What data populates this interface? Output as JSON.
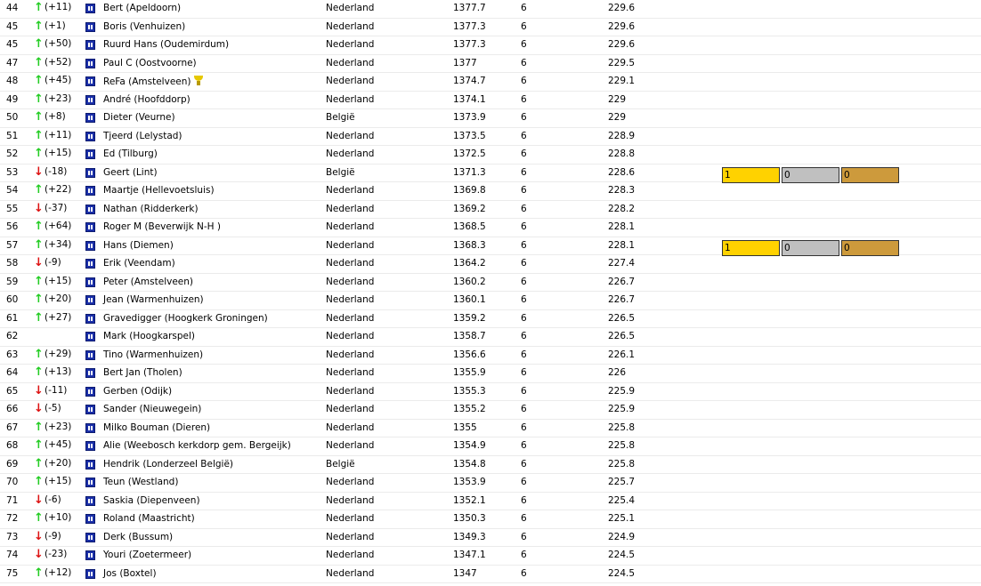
{
  "icons": {
    "trend_up": "arrow-up-icon",
    "trend_down": "arrow-down-icon",
    "flag": "flag-icon",
    "trophy": "trophy-icon"
  },
  "colors": {
    "trend_up": "#22cc22",
    "trend_down": "#dd1111",
    "gold": "#ffd200",
    "silver": "#c0c0c0",
    "bronze": "#cd9a3c"
  },
  "rows": [
    {
      "pos": "44",
      "dir": "up",
      "delta": "(+11)",
      "name": "Bert (Apeldoorn)",
      "country": "Nederland",
      "score": "1377.7",
      "games": "6",
      "avg": "229.6"
    },
    {
      "pos": "45",
      "dir": "up",
      "delta": "(+1)",
      "name": "Boris (Venhuizen)",
      "country": "Nederland",
      "score": "1377.3",
      "games": "6",
      "avg": "229.6"
    },
    {
      "pos": "45",
      "dir": "up",
      "delta": "(+50)",
      "name": "Ruurd Hans (Oudemirdum)",
      "country": "Nederland",
      "score": "1377.3",
      "games": "6",
      "avg": "229.6"
    },
    {
      "pos": "47",
      "dir": "up",
      "delta": "(+52)",
      "name": "Paul C (Oostvoorne)",
      "country": "Nederland",
      "score": "1377",
      "games": "6",
      "avg": "229.5"
    },
    {
      "pos": "48",
      "dir": "up",
      "delta": "(+45)",
      "name": "ReFa (Amstelveen)",
      "trophy": true,
      "country": "Nederland",
      "score": "1374.7",
      "games": "6",
      "avg": "229.1"
    },
    {
      "pos": "49",
      "dir": "up",
      "delta": "(+23)",
      "name": "André (Hoofddorp)",
      "country": "Nederland",
      "score": "1374.1",
      "games": "6",
      "avg": "229"
    },
    {
      "pos": "50",
      "dir": "up",
      "delta": "(+8)",
      "name": "Dieter (Veurne)",
      "country": "België",
      "score": "1373.9",
      "games": "6",
      "avg": "229"
    },
    {
      "pos": "51",
      "dir": "up",
      "delta": "(+11)",
      "name": "Tjeerd (Lelystad)",
      "country": "Nederland",
      "score": "1373.5",
      "games": "6",
      "avg": "228.9"
    },
    {
      "pos": "52",
      "dir": "up",
      "delta": "(+15)",
      "name": "Ed (Tilburg)",
      "country": "Nederland",
      "score": "1372.5",
      "games": "6",
      "avg": "228.8"
    },
    {
      "pos": "53",
      "dir": "down",
      "delta": "(-18)",
      "name": "Geert (Lint)",
      "country": "België",
      "score": "1371.3",
      "games": "6",
      "avg": "228.6",
      "medals": [
        "1",
        "0",
        "0"
      ]
    },
    {
      "pos": "54",
      "dir": "up",
      "delta": "(+22)",
      "name": "Maartje (Hellevoetsluis)",
      "country": "Nederland",
      "score": "1369.8",
      "games": "6",
      "avg": "228.3"
    },
    {
      "pos": "55",
      "dir": "down",
      "delta": "(-37)",
      "name": "Nathan (Ridderkerk)",
      "country": "Nederland",
      "score": "1369.2",
      "games": "6",
      "avg": "228.2"
    },
    {
      "pos": "56",
      "dir": "up",
      "delta": "(+64)",
      "name": "Roger M (Beverwijk N-H )",
      "country": "Nederland",
      "score": "1368.5",
      "games": "6",
      "avg": "228.1"
    },
    {
      "pos": "57",
      "dir": "up",
      "delta": "(+34)",
      "name": "Hans (Diemen)",
      "country": "Nederland",
      "score": "1368.3",
      "games": "6",
      "avg": "228.1",
      "medals": [
        "1",
        "0",
        "0"
      ]
    },
    {
      "pos": "58",
      "dir": "down",
      "delta": "(-9)",
      "name": "Erik (Veendam)",
      "country": "Nederland",
      "score": "1364.2",
      "games": "6",
      "avg": "227.4"
    },
    {
      "pos": "59",
      "dir": "up",
      "delta": "(+15)",
      "name": "Peter (Amstelveen)",
      "country": "Nederland",
      "score": "1360.2",
      "games": "6",
      "avg": "226.7"
    },
    {
      "pos": "60",
      "dir": "up",
      "delta": "(+20)",
      "name": "Jean (Warmenhuizen)",
      "country": "Nederland",
      "score": "1360.1",
      "games": "6",
      "avg": "226.7"
    },
    {
      "pos": "61",
      "dir": "up",
      "delta": "(+27)",
      "name": "Gravedigger (Hoogkerk Groningen)",
      "country": "Nederland",
      "score": "1359.2",
      "games": "6",
      "avg": "226.5"
    },
    {
      "pos": "62",
      "dir": "",
      "delta": "",
      "name": "Mark (Hoogkarspel)",
      "country": "Nederland",
      "score": "1358.7",
      "games": "6",
      "avg": "226.5"
    },
    {
      "pos": "63",
      "dir": "up",
      "delta": "(+29)",
      "name": "Tino (Warmenhuizen)",
      "country": "Nederland",
      "score": "1356.6",
      "games": "6",
      "avg": "226.1"
    },
    {
      "pos": "64",
      "dir": "up",
      "delta": "(+13)",
      "name": "Bert Jan (Tholen)",
      "country": "Nederland",
      "score": "1355.9",
      "games": "6",
      "avg": "226"
    },
    {
      "pos": "65",
      "dir": "down",
      "delta": "(-11)",
      "name": "Gerben (Odijk)",
      "country": "Nederland",
      "score": "1355.3",
      "games": "6",
      "avg": "225.9"
    },
    {
      "pos": "66",
      "dir": "down",
      "delta": "(-5)",
      "name": "Sander (Nieuwegein)",
      "country": "Nederland",
      "score": "1355.2",
      "games": "6",
      "avg": "225.9"
    },
    {
      "pos": "67",
      "dir": "up",
      "delta": "(+23)",
      "name": "Milko Bouman (Dieren)",
      "country": "Nederland",
      "score": "1355",
      "games": "6",
      "avg": "225.8"
    },
    {
      "pos": "68",
      "dir": "up",
      "delta": "(+45)",
      "name": "Alie (Weebosch kerkdorp gem. Bergeijk)",
      "country": "Nederland",
      "score": "1354.9",
      "games": "6",
      "avg": "225.8"
    },
    {
      "pos": "69",
      "dir": "up",
      "delta": "(+20)",
      "name": "Hendrik (Londerzeel België)",
      "country": "België",
      "score": "1354.8",
      "games": "6",
      "avg": "225.8"
    },
    {
      "pos": "70",
      "dir": "up",
      "delta": "(+15)",
      "name": "Teun (Westland)",
      "country": "Nederland",
      "score": "1353.9",
      "games": "6",
      "avg": "225.7"
    },
    {
      "pos": "71",
      "dir": "down",
      "delta": "(-6)",
      "name": "Saskia (Diepenveen)",
      "country": "Nederland",
      "score": "1352.1",
      "games": "6",
      "avg": "225.4"
    },
    {
      "pos": "72",
      "dir": "up",
      "delta": "(+10)",
      "name": "Roland (Maastricht)",
      "country": "Nederland",
      "score": "1350.3",
      "games": "6",
      "avg": "225.1"
    },
    {
      "pos": "73",
      "dir": "down",
      "delta": "(-9)",
      "name": "Derk (Bussum)",
      "country": "Nederland",
      "score": "1349.3",
      "games": "6",
      "avg": "224.9"
    },
    {
      "pos": "74",
      "dir": "down",
      "delta": "(-23)",
      "name": "Youri (Zoetermeer)",
      "country": "Nederland",
      "score": "1347.1",
      "games": "6",
      "avg": "224.5"
    },
    {
      "pos": "75",
      "dir": "up",
      "delta": "(+12)",
      "name": "Jos (Boxtel)",
      "country": "Nederland",
      "score": "1347",
      "games": "6",
      "avg": "224.5"
    }
  ]
}
